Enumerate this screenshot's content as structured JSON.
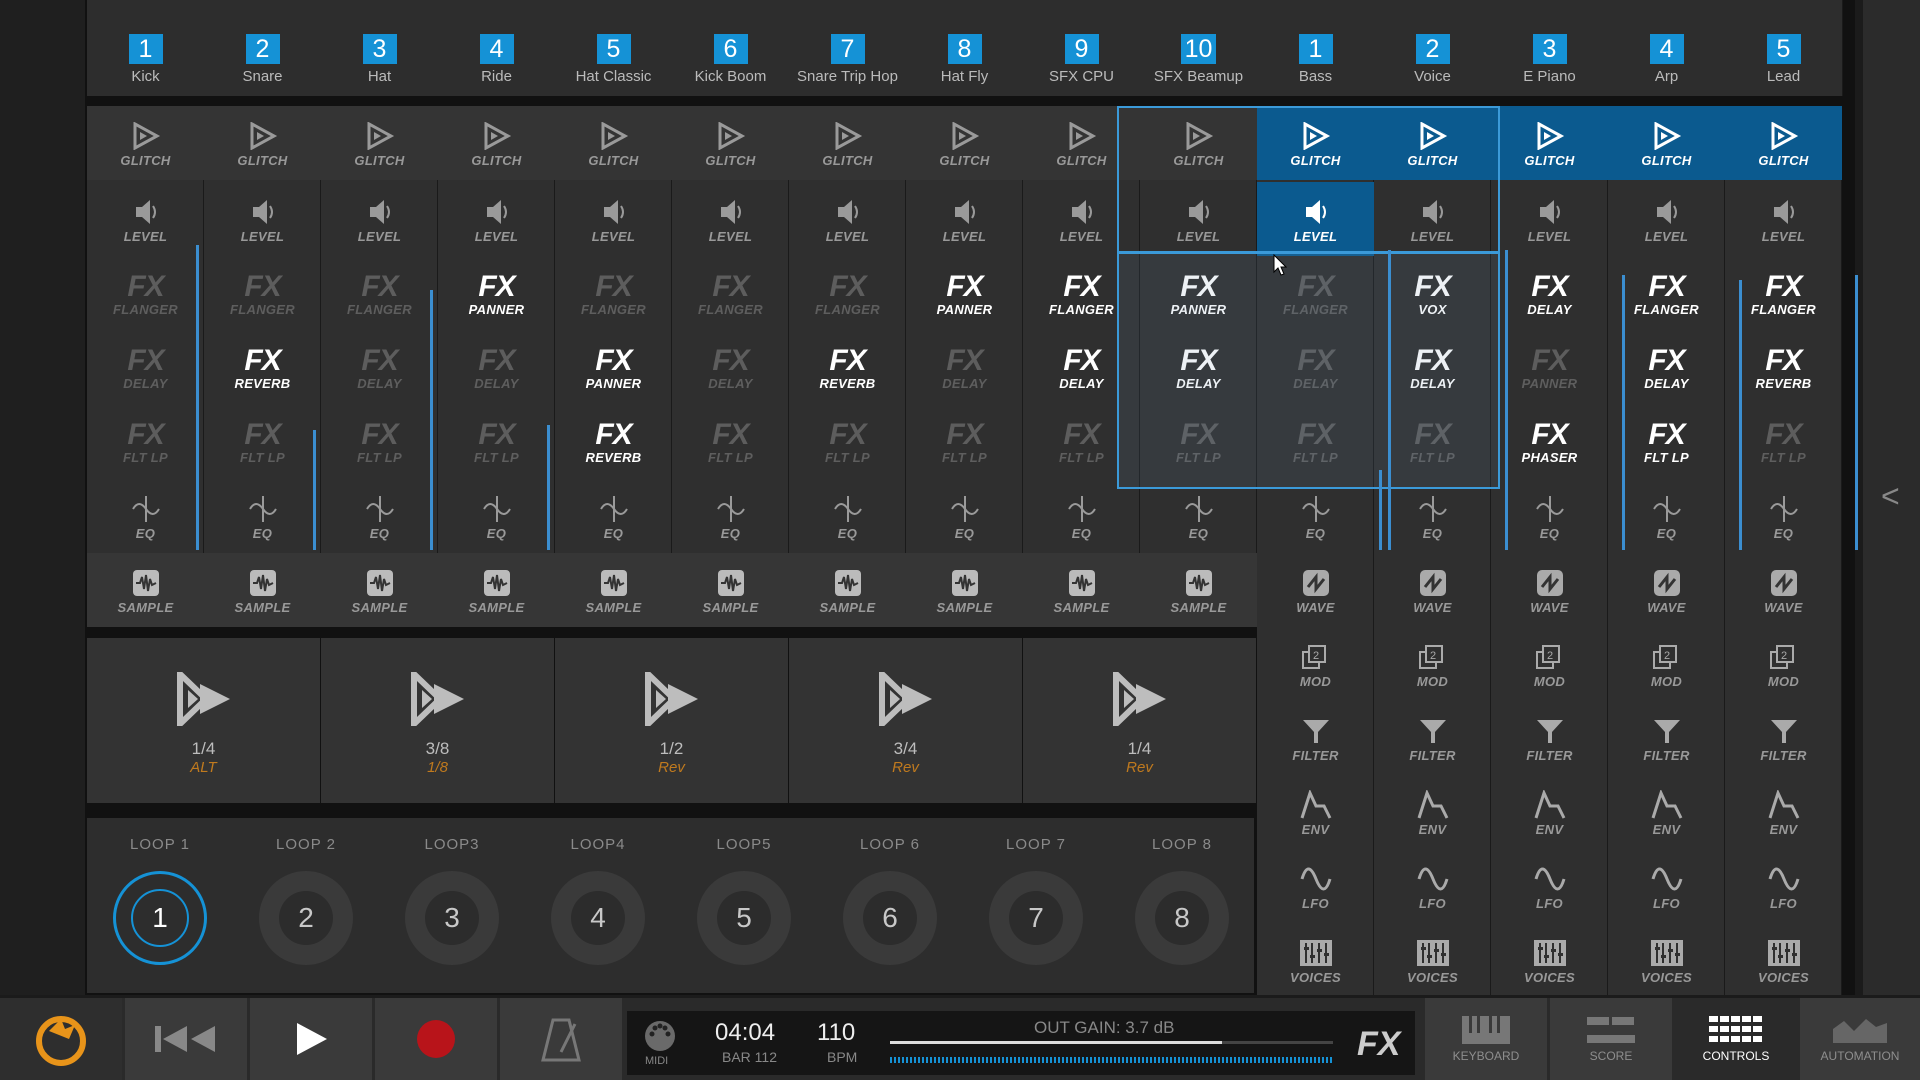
{
  "drum_channels": [
    {
      "num": "1",
      "name": "Kick",
      "fx": [
        "FLANGER",
        "DELAY",
        "FLT LP"
      ],
      "fx_on": [
        false,
        false,
        false
      ]
    },
    {
      "num": "2",
      "name": "Snare",
      "fx": [
        "FLANGER",
        "REVERB",
        "FLT LP"
      ],
      "fx_on": [
        false,
        true,
        false
      ]
    },
    {
      "num": "3",
      "name": "Hat",
      "fx": [
        "FLANGER",
        "DELAY",
        "FLT LP"
      ],
      "fx_on": [
        false,
        false,
        false
      ]
    },
    {
      "num": "4",
      "name": "Ride",
      "fx": [
        "PANNER",
        "DELAY",
        "FLT LP"
      ],
      "fx_on": [
        true,
        false,
        false
      ]
    },
    {
      "num": "5",
      "name": "Hat Classic",
      "fx": [
        "FLANGER",
        "PANNER",
        "REVERB"
      ],
      "fx_on": [
        false,
        true,
        true
      ]
    },
    {
      "num": "6",
      "name": "Kick Boom",
      "fx": [
        "FLANGER",
        "DELAY",
        "FLT LP"
      ],
      "fx_on": [
        false,
        false,
        false
      ]
    },
    {
      "num": "7",
      "name": "Snare Trip Hop",
      "fx": [
        "FLANGER",
        "REVERB",
        "FLT LP"
      ],
      "fx_on": [
        false,
        true,
        false
      ]
    },
    {
      "num": "8",
      "name": "Hat Fly",
      "fx": [
        "PANNER",
        "DELAY",
        "FLT LP"
      ],
      "fx_on": [
        true,
        false,
        false
      ]
    },
    {
      "num": "9",
      "name": "SFX CPU",
      "fx": [
        "FLANGER",
        "DELAY",
        "FLT LP"
      ],
      "fx_on": [
        true,
        true,
        false
      ]
    },
    {
      "num": "10",
      "name": "SFX Beamup",
      "fx": [
        "PANNER",
        "DELAY",
        "FLT LP"
      ],
      "fx_on": [
        true,
        true,
        false
      ]
    }
  ],
  "synth_channels": [
    {
      "num": "1",
      "name": "Bass",
      "fx": [
        "FLANGER",
        "DELAY",
        "FLT LP"
      ],
      "fx_on": [
        false,
        false,
        false
      ]
    },
    {
      "num": "2",
      "name": "Voice",
      "fx": [
        "VOX",
        "DELAY",
        "FLT LP"
      ],
      "fx_on": [
        true,
        true,
        false
      ]
    },
    {
      "num": "3",
      "name": "E Piano",
      "fx": [
        "DELAY",
        "PANNER",
        "PHASER"
      ],
      "fx_on": [
        true,
        false,
        true
      ]
    },
    {
      "num": "4",
      "name": "Arp",
      "fx": [
        "FLANGER",
        "DELAY",
        "FLT LP"
      ],
      "fx_on": [
        true,
        true,
        true
      ]
    },
    {
      "num": "5",
      "name": "Lead",
      "fx": [
        "FLANGER",
        "REVERB",
        "FLT LP"
      ],
      "fx_on": [
        true,
        true,
        false
      ]
    }
  ],
  "labels": {
    "glitch": "GLITCH",
    "level": "LEVEL",
    "fx": "FX",
    "eq": "EQ",
    "sample": "SAMPLE",
    "wave": "WAVE",
    "mod": "MOD",
    "filter": "FILTER",
    "env": "ENV",
    "lfo": "LFO",
    "voices": "VOICES"
  },
  "beat_pads": [
    {
      "value": "1/4",
      "sub": "ALT"
    },
    {
      "value": "3/8",
      "sub": "1/8"
    },
    {
      "value": "1/2",
      "sub": "Rev"
    },
    {
      "value": "3/4",
      "sub": "Rev"
    },
    {
      "value": "1/4",
      "sub": "Rev"
    }
  ],
  "loops": [
    {
      "name": "LOOP 1",
      "num": "1"
    },
    {
      "name": "LOOP 2",
      "num": "2"
    },
    {
      "name": "LOOP3",
      "num": "3"
    },
    {
      "name": "LOOP4",
      "num": "4"
    },
    {
      "name": "LOOP5",
      "num": "5"
    },
    {
      "name": "LOOP 6",
      "num": "6"
    },
    {
      "name": "LOOP 7",
      "num": "7"
    },
    {
      "name": "LOOP 8",
      "num": "8"
    }
  ],
  "transport": {
    "midi_label": "MIDI",
    "time": "04:04",
    "bar": "BAR 112",
    "bpm_value": "110",
    "bpm_label": "BPM",
    "out_gain": "OUT GAIN: 3.7 dB",
    "fx_label": "FX",
    "gain_level": 0.75
  },
  "nav": {
    "keyboard": "KEYBOARD",
    "score": "SCORE",
    "controls": "CONTROLS",
    "automation": "AUTOMATION"
  },
  "side_arrow": "<",
  "colors": {
    "accent": "#1592d6",
    "selected_blue": "#0b5a8f",
    "orange": "#c07a1e"
  }
}
